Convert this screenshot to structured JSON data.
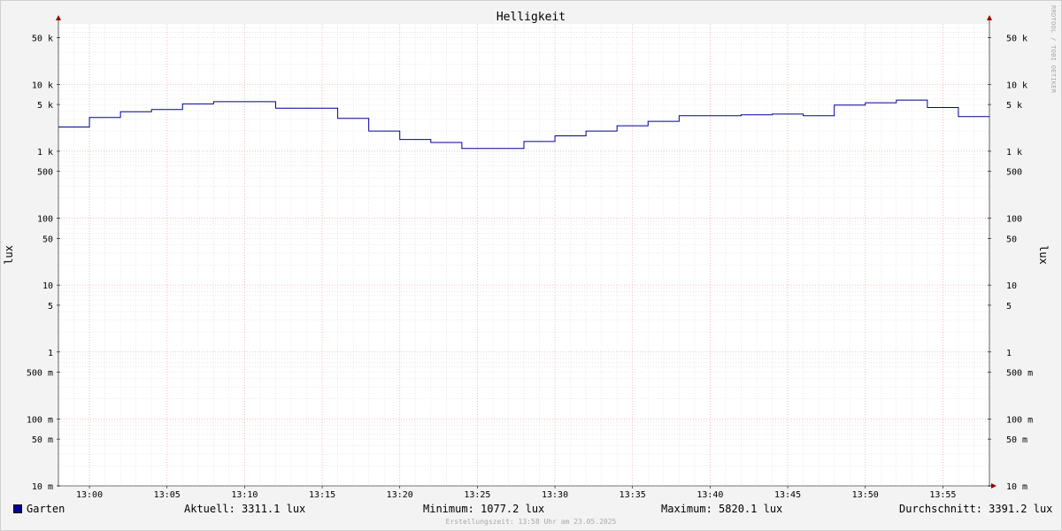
{
  "chart_data": {
    "type": "line",
    "title": "Helligkeit",
    "ylabel_left": "lux",
    "ylabel_right": "lux",
    "watermark": "RRDTOOL / TOBI OETIKER",
    "y_scale": "log",
    "ylim": [
      0.01,
      80000
    ],
    "xlim": [
      "12:58",
      "13:58"
    ],
    "x_ticks": [
      "13:00",
      "13:05",
      "13:10",
      "13:15",
      "13:20",
      "13:25",
      "13:30",
      "13:35",
      "13:40",
      "13:45",
      "13:50",
      "13:55"
    ],
    "y_ticks": [
      {
        "value": 0.01,
        "label": "10 m"
      },
      {
        "value": 0.05,
        "label": "50 m"
      },
      {
        "value": 0.1,
        "label": "100 m"
      },
      {
        "value": 0.5,
        "label": "500 m"
      },
      {
        "value": 1,
        "label": "1"
      },
      {
        "value": 5,
        "label": "5"
      },
      {
        "value": 10,
        "label": "10"
      },
      {
        "value": 50,
        "label": "50"
      },
      {
        "value": 100,
        "label": "100"
      },
      {
        "value": 500,
        "label": "500"
      },
      {
        "value": 1000,
        "label": "1 k"
      },
      {
        "value": 5000,
        "label": "5 k"
      },
      {
        "value": 10000,
        "label": "10 k"
      },
      {
        "value": 50000,
        "label": "50 k"
      }
    ],
    "grid": true,
    "series": [
      {
        "name": "Garten",
        "color": "#000099",
        "x": [
          "12:58",
          "13:00",
          "13:02",
          "13:04",
          "13:06",
          "13:08",
          "13:10",
          "13:12",
          "13:14",
          "13:16",
          "13:18",
          "13:20",
          "13:22",
          "13:24",
          "13:26",
          "13:28",
          "13:30",
          "13:32",
          "13:34",
          "13:36",
          "13:38",
          "13:40",
          "13:42",
          "13:44",
          "13:46",
          "13:48",
          "13:50",
          "13:52",
          "13:54",
          "13:56"
        ],
        "values": [
          2300,
          3200,
          3900,
          4200,
          5100,
          5500,
          5500,
          4400,
          4400,
          3100,
          2000,
          1500,
          1350,
          1100,
          1100,
          1400,
          1700,
          2000,
          2400,
          2800,
          3400,
          3400,
          3500,
          3600,
          3400,
          4900,
          5300,
          5800,
          4500,
          3300
        ]
      }
    ]
  },
  "legend": {
    "series_name": "Garten",
    "current": "Aktuell: 3311.1 lux",
    "minimum": "Minimum: 1077.2 lux",
    "maximum": "Maximum: 5820.1 lux",
    "average": "Durchschnitt: 3391.2 lux"
  },
  "footer": "Erstellungszeit: 13:58 Uhr am 23.05.2025"
}
